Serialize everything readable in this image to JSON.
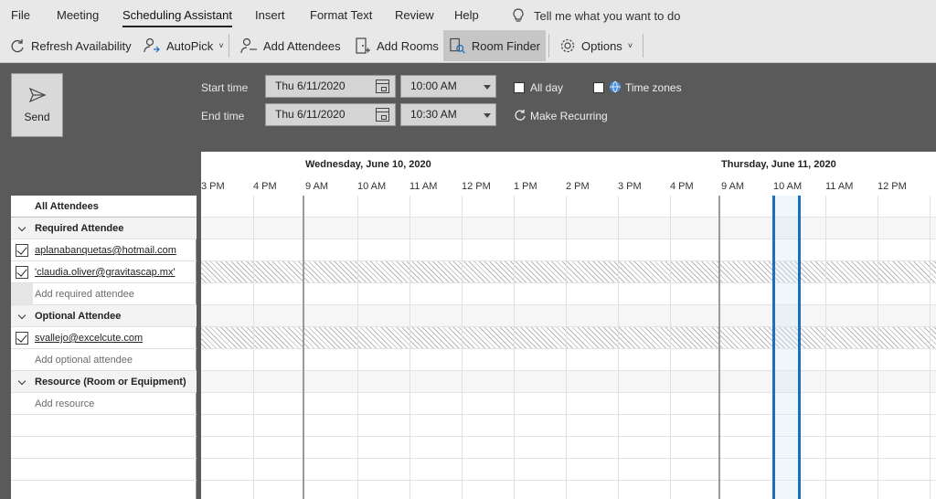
{
  "menu": {
    "file": "File",
    "meeting": "Meeting",
    "scheduling": "Scheduling Assistant",
    "insert": "Insert",
    "format": "Format Text",
    "review": "Review",
    "help": "Help",
    "tellme": "Tell me what you want to do"
  },
  "ribbon": {
    "refresh": "Refresh Availability",
    "autopick": "AutoPick",
    "add_attendees": "Add Attendees",
    "add_rooms": "Add Rooms",
    "room_finder": "Room Finder",
    "options": "Options"
  },
  "send": {
    "label": "Send"
  },
  "times": {
    "start_label": "Start time",
    "end_label": "End time",
    "start_date": "Thu 6/11/2020",
    "end_date": "Thu 6/11/2020",
    "start_time": "10:00 AM",
    "end_time": "10:30 AM",
    "all_day": "All day",
    "time_zones": "Time zones",
    "make_recurring": "Make Recurring"
  },
  "timeline": {
    "day1": "Wednesday, June 10, 2020",
    "day2": "Thursday, June 11, 2020",
    "hours": [
      "3 PM",
      "4 PM",
      "9 AM",
      "10 AM",
      "11 AM",
      "12 PM",
      "1 PM",
      "2 PM",
      "3 PM",
      "4 PM",
      "9 AM",
      "10 AM",
      "11 AM",
      "12 PM"
    ]
  },
  "attendees": {
    "all": "All Attendees",
    "required_group": "Required Attendee",
    "req1": "aplanabanquetas@hotmail.com",
    "req2": "'claudia.oliver@gravitascap.mx'",
    "add_required": "Add required attendee",
    "optional_group": "Optional Attendee",
    "opt1": "svallejo@excelcute.com",
    "add_optional": "Add optional attendee",
    "resource_group": "Resource (Room or Equipment)",
    "add_resource": "Add resource"
  },
  "colors": {
    "meeting_border": "#1a6fc2",
    "ribbon_bg": "#e8e8e8",
    "form_bg": "#5a5a5a"
  }
}
